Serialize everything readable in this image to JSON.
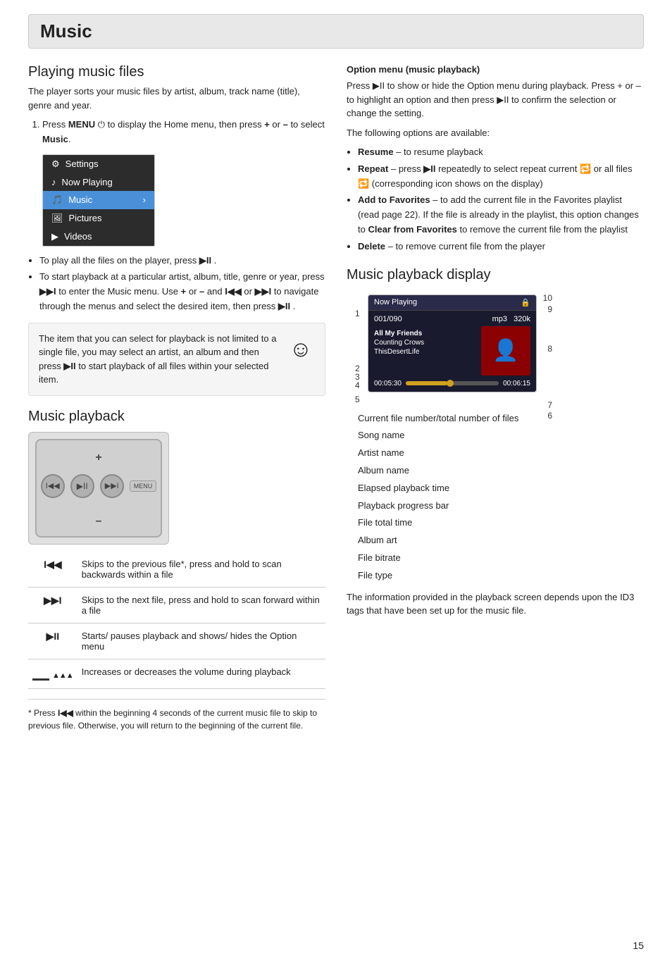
{
  "page": {
    "title": "Music",
    "page_number": "15"
  },
  "playing_music_files": {
    "heading": "Playing music files",
    "intro": "The player sorts your music files by artist, album, track name (title), genre and year.",
    "step1": "Press MENU ⏻ to display the Home menu, then press + or – to select Music.",
    "menu_items": [
      {
        "label": "Settings",
        "active": false
      },
      {
        "label": "Now Playing",
        "active": false
      },
      {
        "label": "Music",
        "active": true
      },
      {
        "label": "Pictures",
        "active": false
      },
      {
        "label": "Videos",
        "active": false
      }
    ],
    "bullets": [
      "To play all the files on the player, press ▶II .",
      "To start playback at a particular artist, album, title, genre or year, press ▶▶I to enter the Music menu. Use + or – and I◀◀ or ▶▶I to navigate through the menus and select the desired item, then press ▶II ."
    ],
    "note_text": "The item that you can select for playback is not limited to a single file, you may select an artist, an album and then press ▶II to start playback of all files within your selected item."
  },
  "music_playback": {
    "heading": "Music playback",
    "controls": [
      {
        "symbol": "I◀◀",
        "description": "Skips to the previous file*, press and hold to scan backwards within a file"
      },
      {
        "symbol": "▶▶I",
        "description": "Skips to the next file, press and hold to scan forward within a file"
      },
      {
        "symbol": "▶II",
        "description": "Starts/ pauses playback and shows/ hides the Option menu"
      },
      {
        "symbol": "≋",
        "description": "Increases or decreases the volume during playback"
      }
    ],
    "footnote": "* Press I◀◀ within the beginning 4 seconds of the current music file to skip to previous file. Otherwise, you will return to the beginning of the current file."
  },
  "option_menu": {
    "heading": "Option menu (music playback)",
    "intro": "Press ▶II to show or hide the Option menu during playback. Press + or – to highlight an option and then press ▶II to confirm the selection or change the setting.",
    "options_intro": "The following options are available:",
    "options": [
      {
        "name": "Resume",
        "desc": "– to resume playback"
      },
      {
        "name": "Repeat",
        "desc": "– press ▶II repeatedly to select repeat current 🔁 or all files 🔁 (corresponding icon shows on the display)"
      },
      {
        "name": "Add to Favorites",
        "desc": "– to add the current file in the Favorites playlist (read page 22). If the file is already in the playlist, this option changes to Clear from Favorites to remove the current file from the playlist"
      },
      {
        "name": "Delete",
        "desc": "– to remove current file from the player"
      }
    ]
  },
  "playback_display": {
    "heading": "Music playback display",
    "now_playing_label": "Now Playing",
    "track_num": "001/090",
    "format": "mp3",
    "bitrate": "320k",
    "song_name": "All My Friends",
    "artist_name": "Counting Crows",
    "album_name": "ThisDesertLife",
    "elapsed": "00:05:30",
    "total": "00:06:15",
    "progress_pct": 45,
    "numbered_items": [
      "Current file number/total number of files",
      "Song name",
      "Artist name",
      "Album name",
      "Elapsed playback time",
      "Playback progress bar",
      "File total time",
      "Album art",
      "File bitrate",
      "File type"
    ],
    "info_text": "The information provided in the playback screen depends upon the ID3 tags that have been set up for the music file."
  }
}
